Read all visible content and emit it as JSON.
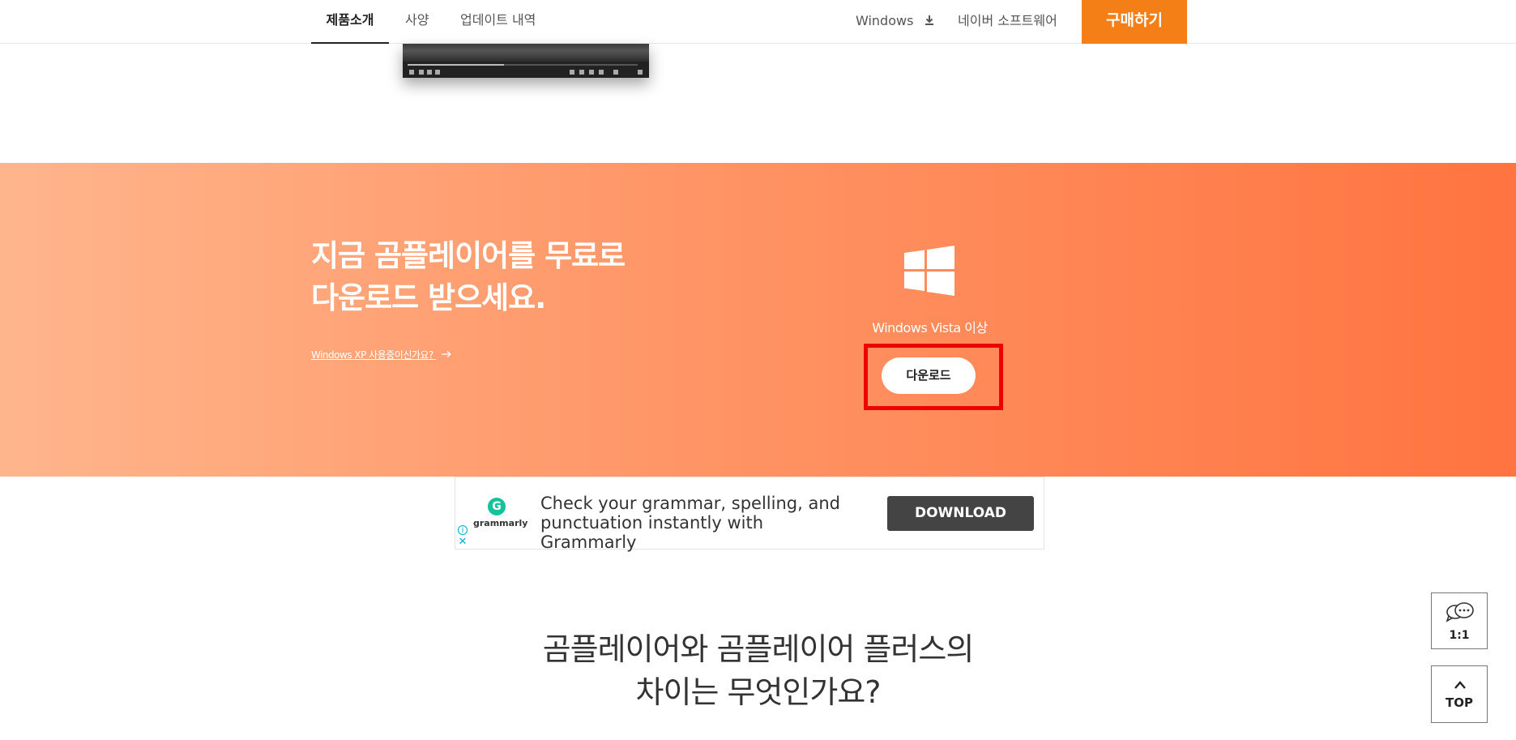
{
  "nav": {
    "tabs": [
      {
        "label": "제품소개",
        "active": true
      },
      {
        "label": "사양",
        "active": false
      },
      {
        "label": "업데이트 내역",
        "active": false
      }
    ],
    "windows_label": "Windows",
    "naver_label": "네이버 소프트웨어",
    "buy_label": "구매하기"
  },
  "video": {
    "progress": 0.42
  },
  "banner": {
    "headline_line1": "지금 곰플레이어를 무료로",
    "headline_line2": "다운로드 받으세요.",
    "xp_link": "Windows XP 사용중이신가요?",
    "os_label": "Windows Vista 이상",
    "download_label": "다운로드"
  },
  "ad": {
    "brand": "grammarly",
    "text": "Check your grammar, spelling, and punctuation instantly with Grammarly",
    "cta": "DOWNLOAD"
  },
  "section": {
    "title_line1": "곰플레이어와 곰플레이어 플러스의",
    "title_line2": "차이는 무엇인가요?"
  },
  "floating": {
    "chat_label": "1:1",
    "top_label": "TOP"
  },
  "colors": {
    "brand_orange": "#f57f17",
    "banner_start": "#ffb58c",
    "banner_end": "#ff7440",
    "highlight": "#ee0000",
    "grammarly_green": "#15c39a"
  }
}
